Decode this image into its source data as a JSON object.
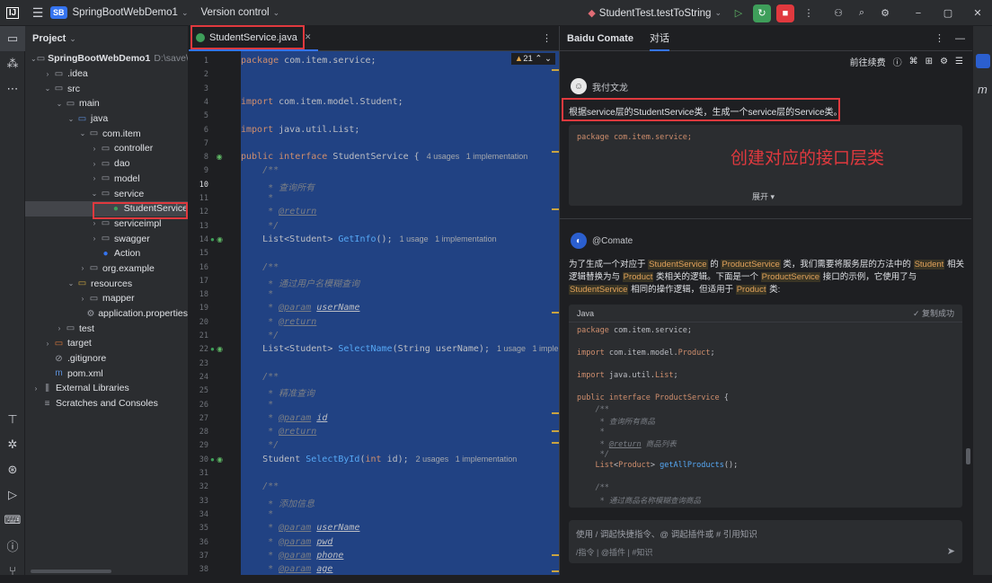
{
  "titlebar": {
    "project_badge": "SB",
    "project_name": "SpringBootWebDemo1",
    "vcs": "Version control",
    "run_config": "StudentTest.testToString"
  },
  "project_panel": {
    "title": "Project",
    "items": [
      {
        "label": "SpringBootWebDemo1",
        "path": "D:\\save\\stu",
        "icon": "folder",
        "level": 0,
        "open": true,
        "bold": true
      },
      {
        "label": ".idea",
        "icon": "folder",
        "level": 1,
        "open": false
      },
      {
        "label": "src",
        "icon": "folder",
        "level": 1,
        "open": true
      },
      {
        "label": "main",
        "icon": "folder",
        "level": 2,
        "open": true
      },
      {
        "label": "java",
        "icon": "folder-source",
        "level": 3,
        "open": true
      },
      {
        "label": "com.item",
        "icon": "package",
        "level": 4,
        "open": true
      },
      {
        "label": "controller",
        "icon": "package",
        "level": 5,
        "open": false
      },
      {
        "label": "dao",
        "icon": "package",
        "level": 5,
        "open": false
      },
      {
        "label": "model",
        "icon": "package",
        "level": 5,
        "open": false
      },
      {
        "label": "service",
        "icon": "package",
        "level": 5,
        "open": true
      },
      {
        "label": "StudentService",
        "icon": "interface",
        "level": 6,
        "selected": true
      },
      {
        "label": "serviceimpl",
        "icon": "package",
        "level": 5,
        "open": false
      },
      {
        "label": "swagger",
        "icon": "package",
        "level": 5,
        "open": false
      },
      {
        "label": "Action",
        "icon": "class",
        "level": 5
      },
      {
        "label": "org.example",
        "icon": "package",
        "level": 4,
        "open": false
      },
      {
        "label": "resources",
        "icon": "folder-res",
        "level": 3,
        "open": true
      },
      {
        "label": "mapper",
        "icon": "folder",
        "level": 4,
        "open": false
      },
      {
        "label": "application.properties",
        "icon": "gear",
        "level": 4
      },
      {
        "label": "test",
        "icon": "folder",
        "level": 2,
        "open": false
      },
      {
        "label": "target",
        "icon": "folder-excluded",
        "level": 1,
        "open": false
      },
      {
        "label": ".gitignore",
        "icon": "ignore",
        "level": 1
      },
      {
        "label": "pom.xml",
        "icon": "maven",
        "level": 1
      },
      {
        "label": "External Libraries",
        "icon": "library",
        "level": 0,
        "open": false
      },
      {
        "label": "Scratches and Consoles",
        "icon": "scratch",
        "level": 0
      }
    ]
  },
  "editor": {
    "tab": "StudentService.java",
    "warnings": "21",
    "lines": [
      {
        "n": "1",
        "html": "<span class=kw>package</span> com.item.service;"
      },
      {
        "n": "2",
        "html": ""
      },
      {
        "n": "3",
        "html": ""
      },
      {
        "n": "4",
        "html": "<span class=kw>import</span> com.item.model.Student;"
      },
      {
        "n": "5",
        "html": ""
      },
      {
        "n": "6",
        "html": "<span class=kw>import</span> java.util.List;"
      },
      {
        "n": "7",
        "html": ""
      },
      {
        "n": "8",
        "html": "<span class=kw>public interface</span> StudentService {<span class=hint>4 usages   1 implementation</span>",
        "g": "impl"
      },
      {
        "n": "9",
        "html": "    <span class=cm>/**</span>"
      },
      {
        "n": "10",
        "html": "     <span class=cm>* 查询所有</span>"
      },
      {
        "n": "11",
        "html": "     <span class=cm>*</span>"
      },
      {
        "n": "12",
        "html": "     <span class=cm>* </span><span class=tg>@return</span>"
      },
      {
        "n": "13",
        "html": "     <span class=cm>*/</span>"
      },
      {
        "n": "14",
        "html": "    List&lt;Student&gt; <span class=fn>GetInfo</span>();<span class=hint>1 usage   1 implementation</span>",
        "g": "both"
      },
      {
        "n": "15",
        "html": ""
      },
      {
        "n": "16",
        "html": "    <span class=cm>/**</span>"
      },
      {
        "n": "17",
        "html": "     <span class=cm>* 通过用户名模糊查询</span>"
      },
      {
        "n": "18",
        "html": "     <span class=cm>*</span>"
      },
      {
        "n": "19",
        "html": "     <span class=cm>* </span><span class=tg>@param</span> <span class=pr>userName</span>"
      },
      {
        "n": "20",
        "html": "     <span class=cm>* </span><span class=tg>@return</span>"
      },
      {
        "n": "21",
        "html": "     <span class=cm>*/</span>"
      },
      {
        "n": "22",
        "html": "    List&lt;Student&gt; <span class=fn>SelectName</span>(String userName);<span class=hint>1 usage   1 implement</span>",
        "g": "both"
      },
      {
        "n": "23",
        "html": ""
      },
      {
        "n": "24",
        "html": "    <span class=cm>/**</span>"
      },
      {
        "n": "25",
        "html": "     <span class=cm>* 精准查询</span>"
      },
      {
        "n": "26",
        "html": "     <span class=cm>*</span>"
      },
      {
        "n": "27",
        "html": "     <span class=cm>* </span><span class=tg>@param</span> <span class=pr>id</span>"
      },
      {
        "n": "28",
        "html": "     <span class=cm>* </span><span class=tg>@return</span>"
      },
      {
        "n": "29",
        "html": "     <span class=cm>*/</span>"
      },
      {
        "n": "30",
        "html": "    Student <span class=fn>SelectById</span>(<span class=kw>int</span> id);<span class=hint>2 usages   1 implementation</span>",
        "g": "both"
      },
      {
        "n": "31",
        "html": ""
      },
      {
        "n": "32",
        "html": "    <span class=cm>/**</span>"
      },
      {
        "n": "33",
        "html": "     <span class=cm>* 添加信息</span>"
      },
      {
        "n": "34",
        "html": "     <span class=cm>*</span>"
      },
      {
        "n": "35",
        "html": "     <span class=cm>* </span><span class=tg>@param</span> <span class=pr>userName</span>"
      },
      {
        "n": "36",
        "html": "     <span class=cm>* </span><span class=tg>@param</span> <span class=pr>pwd</span>"
      },
      {
        "n": "37",
        "html": "     <span class=cm>* </span><span class=tg>@param</span> <span class=pr>phone</span>"
      },
      {
        "n": "38",
        "html": "     <span class=cm>* </span><span class=tg>@param</span> <span class=pr>age</span>"
      }
    ]
  },
  "comate": {
    "title": "Baidu Comate",
    "tab": "对话",
    "toolbar_link": "前往续费",
    "user_name": "我付文龙",
    "user_message": "根据service层的StudentService类，生成一个service层的Service类。",
    "user_code": "package com.item.service;",
    "annotation": "创建对应的接口层类",
    "expand": "展开 ▾",
    "bot_name": "@Comate",
    "bot_text_html": "为了生成一个对应于 <span class=hl>StudentService</span> 的 <span class=hl>ProductService</span> 类，我们需要将服务层的方法中的 <span class=hl>Student</span> 相关逻辑替换为与 <span class=hl>Product</span> 类相关的逻辑。下面是一个 <span class=hl>ProductService</span> 接口的示例，它使用了与 <span class=hl>StudentService</span> 相同的操作逻辑，但适用于 <span class=hl>Product</span> 类:",
    "code_lang": "Java",
    "copy_status": "✓ 复制成功",
    "code_lines": [
      "<span class=kw>package</span> com.item.service;",
      "",
      "<span class=kw>import</span> com.item.model.<span class=kw>Product</span>;",
      "",
      "<span class=kw>import</span> java.util.<span class=kw>List</span>;",
      "",
      "<span class=kw>public interface</span> <span class=kw>ProductService</span> {",
      "    <span class=cm>/**</span>",
      "     <span class=cm>* 查询所有商品</span>",
      "     <span class=cm>*</span>",
      "     <span class=cm>* </span><span class=tg>@return</span> <span class=cm>商品列表</span>",
      "     <span class=cm>*/</span>",
      "    <span class=kw>List</span>&lt;<span class=kw>Product</span>&gt; <span class=fn>getAllProducts</span>();",
      "",
      "    <span class=cm>/**</span>",
      "     <span class=cm>* 通过商品名称模糊查询商品</span>"
    ],
    "input_placeholder": "使用 / 调起快捷指令、@ 调起插件或 # 引用知识",
    "input_hints": "/指令  |  @插件  |  #知识"
  },
  "colors": {
    "selection": "#214283",
    "accent": "#3574f0",
    "annotation_red": "#e0393e"
  }
}
